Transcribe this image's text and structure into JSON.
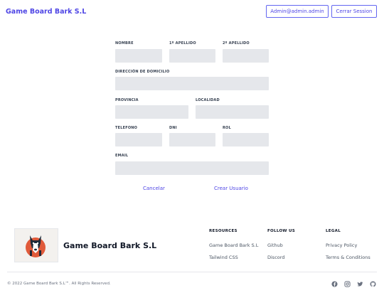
{
  "header": {
    "brand": "Game Board Bark S.L",
    "user_button": "Admin@admin.admin",
    "logout_button": "Cerrar Session"
  },
  "form": {
    "nombre_label": "NOMBRE",
    "apellido1_label": "1º APELLIDO",
    "apellido2_label": "2º APELLIDO",
    "direccion_label": "DIRECCIÓN DE DOMICILIO",
    "provincia_label": "PROVINCIA",
    "localidad_label": "LOCALIDAD",
    "telefono_label": "TELEFONO",
    "dni_label": "DNI",
    "rol_label": "ROL",
    "email_label": "EMAIL",
    "cancel_link": "Cancelar",
    "create_link": "Crear Usuario"
  },
  "footer": {
    "name": "Game Board Bark S.L",
    "resources": {
      "heading": "RESOURCES",
      "items": [
        "Game Board Bark S.L",
        "Tailwind CSS"
      ]
    },
    "follow": {
      "heading": "FOLLOW US",
      "items": [
        "Github",
        "Discord"
      ]
    },
    "legal": {
      "heading": "LEGAL",
      "items": [
        "Privacy Policy",
        "Terms & Conditions"
      ]
    },
    "copyright": "© 2022 Game Board Bark S.L™. All Rights Reserved.",
    "social_icons": [
      "facebook-icon",
      "instagram-icon",
      "twitter-icon",
      "github-icon"
    ]
  },
  "colors": {
    "accent": "#4f46e5",
    "field_bg": "#e5e7eb"
  }
}
